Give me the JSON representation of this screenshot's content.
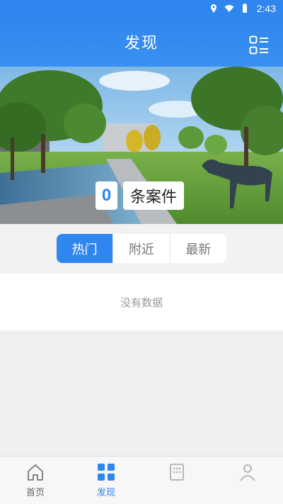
{
  "status_bar": {
    "time": "2:43",
    "icons": [
      "location-icon",
      "wifi-icon",
      "battery-icon"
    ]
  },
  "header": {
    "title": "发现",
    "menu_icon": "list-grid-icon"
  },
  "banner": {
    "case_count": "0",
    "case_label": "条案件"
  },
  "tabs": {
    "items": [
      {
        "label": "热门",
        "active": true
      },
      {
        "label": "附近",
        "active": false
      },
      {
        "label": "最新",
        "active": false
      }
    ]
  },
  "list": {
    "empty_text": "没有数据"
  },
  "bottom_nav": {
    "items": [
      {
        "label": "首页",
        "icon": "home-icon",
        "active": false
      },
      {
        "label": "发现",
        "icon": "grid-icon",
        "active": true
      },
      {
        "label": "",
        "icon": "building-icon",
        "active": false
      },
      {
        "label": "",
        "icon": "user-icon",
        "active": false
      }
    ]
  },
  "colors": {
    "primary": "#2f86ee",
    "background": "#f0f0f0",
    "text_muted": "#999999"
  }
}
